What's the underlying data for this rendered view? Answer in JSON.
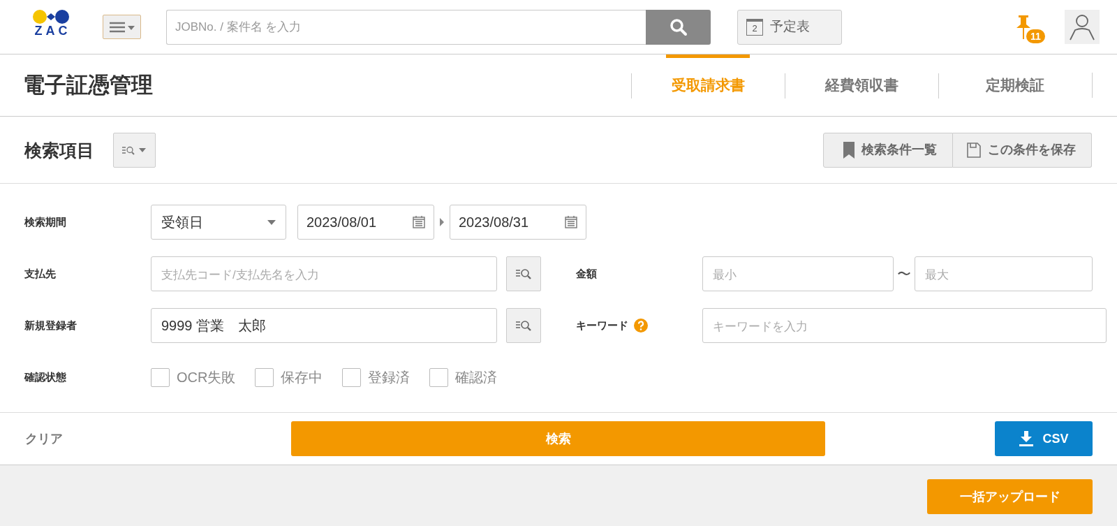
{
  "header": {
    "logo": "ZAC",
    "search": {
      "placeholder": "JOBNo. / 案件名 を入力"
    },
    "schedule_button": {
      "day": "2",
      "label": "予定表"
    },
    "pin_count": "11"
  },
  "page_title": "電子証憑管理",
  "tabs": [
    {
      "label": "受取請求書",
      "selected": true
    },
    {
      "label": "経費領収書",
      "selected": false
    },
    {
      "label": "定期検証",
      "selected": false
    }
  ],
  "search_section": {
    "title": "検索項目",
    "buttons": [
      {
        "kind": "bookmark",
        "label": "検索条件一覧"
      },
      {
        "kind": "save",
        "label": "この条件を保存"
      }
    ]
  },
  "form": {
    "period": {
      "label": "検索期間",
      "date_type": "受領日",
      "from": "2023/08/01",
      "to": "2023/08/31"
    },
    "payee": {
      "label": "支払先",
      "placeholder": "支払先コード/支払先名を入力"
    },
    "amount": {
      "label": "金額",
      "min_placeholder": "最小",
      "separator": "〜",
      "max_placeholder": "最大"
    },
    "registrant": {
      "label": "新規登録者",
      "value": "9999 営業　太郎"
    },
    "keyword": {
      "label": "キーワード",
      "placeholder": "キーワードを入力"
    },
    "status": {
      "label": "確認状態",
      "options": [
        {
          "label": "OCR失敗",
          "checked": false
        },
        {
          "label": "保存中",
          "checked": false
        },
        {
          "label": "登録済",
          "checked": false
        },
        {
          "label": "確認済",
          "checked": false
        }
      ]
    }
  },
  "footer": {
    "clear": "クリア",
    "search": "検索",
    "csv": "CSV"
  },
  "upload_button": "一括アップロード"
}
